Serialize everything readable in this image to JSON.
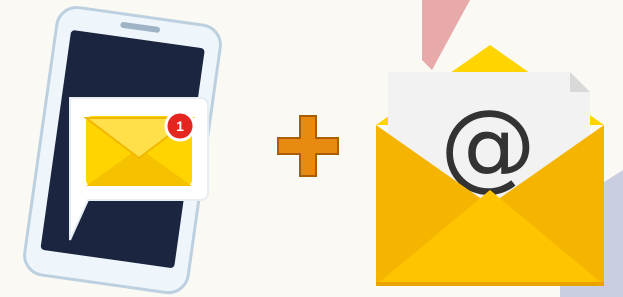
{
  "notification": {
    "badge_count": "1"
  },
  "email": {
    "symbol": "@"
  },
  "operator": {
    "symbol": "+",
    "icon": "plus-icon"
  },
  "colors": {
    "background": "#fbf9f3",
    "phone_frame": "#eef6fb",
    "phone_screen": "#1b2540",
    "envelope_yellow": "#ffd400",
    "envelope_dark": "#f4a900",
    "badge_red": "#e52620",
    "plus_orange": "#e98a10",
    "letter_paper": "#f2f2f2"
  }
}
